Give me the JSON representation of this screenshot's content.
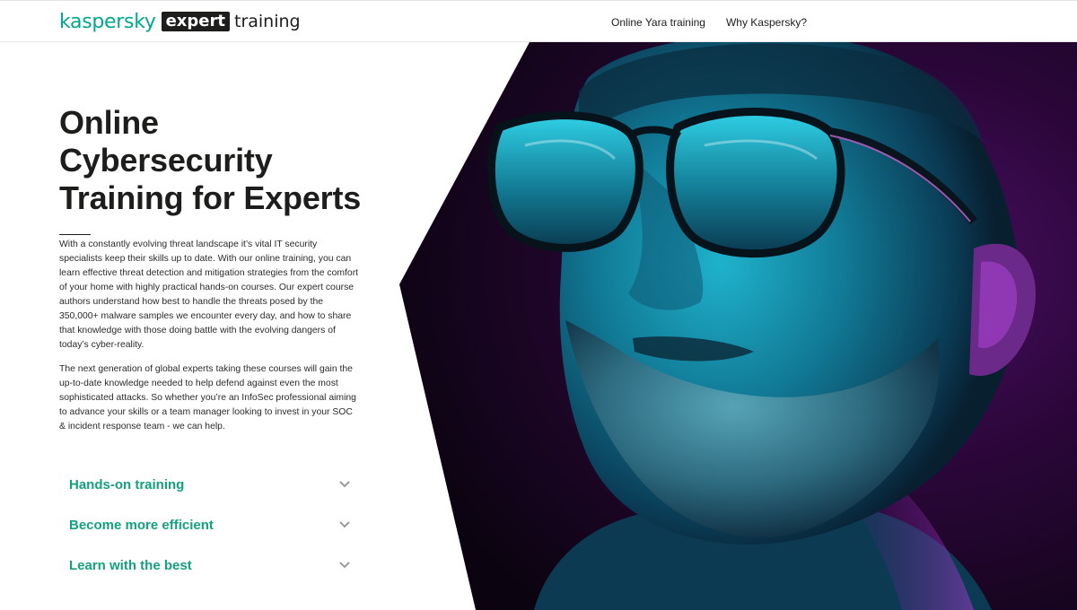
{
  "header": {
    "logo": {
      "brand": "kaspersky",
      "badge": "expert",
      "product": "training"
    },
    "nav": [
      {
        "label": "Online Yara training"
      },
      {
        "label": "Why Kaspersky?"
      }
    ]
  },
  "hero": {
    "title": "Online\nCybersecurity\nTraining for Experts",
    "paragraphs": [
      "With a constantly evolving threat landscape it’s vital IT security specialists keep their skills up to date. With our online training, you can learn effective threat detection and mitigation strategies from the comfort of your home with highly practical hands-on courses. Our expert course authors understand how best to handle the threats posed by the 350,000+ malware samples we encounter every day, and how to share that knowledge with those doing battle with the evolving dangers of today’s cyber-reality.",
      "The next generation of global experts taking these courses will gain the up-to-date knowledge needed to help defend against even the most sophisticated attacks. So whether you’re an InfoSec professional aiming to advance your skills or a team manager looking to invest in your SOC & incident response team - we can help."
    ],
    "image": {
      "description_icon": "man-with-glasses-photo"
    }
  },
  "accordion": [
    {
      "label": "Hands-on training",
      "icon": "chevron-down-icon"
    },
    {
      "label": "Become more efficient",
      "icon": "chevron-down-icon"
    },
    {
      "label": "Learn with the best",
      "icon": "chevron-down-icon"
    }
  ],
  "colors": {
    "brand_green": "#00a88e",
    "accordion_green": "#15a080",
    "text_dark": "#1d1d1b",
    "hero_purple": "#3b0a4f",
    "hero_cyan": "#19b7d1"
  }
}
